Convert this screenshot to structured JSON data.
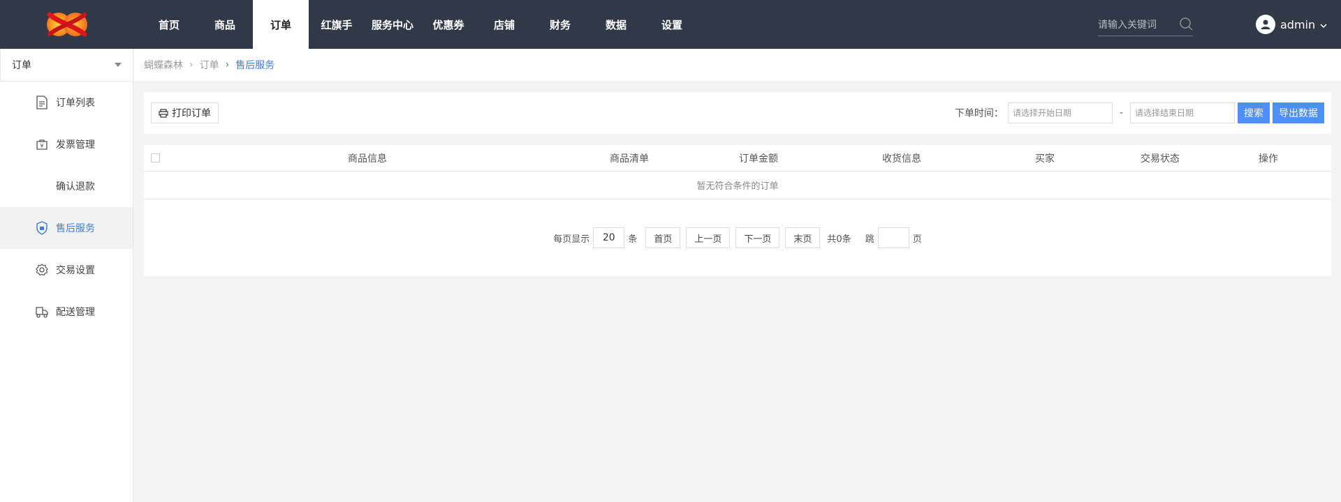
{
  "header": {
    "logo_icon": "colorful-knot-logo",
    "nav": [
      {
        "label": "首页"
      },
      {
        "label": "商品"
      },
      {
        "label": "订单",
        "active": true
      },
      {
        "label": "红旗手"
      },
      {
        "label": "服务中心"
      },
      {
        "label": "优惠券"
      },
      {
        "label": "店铺"
      },
      {
        "label": "财务"
      },
      {
        "label": "数据"
      },
      {
        "label": "设置"
      }
    ],
    "search": {
      "placeholder": "请输入关键词",
      "value": ""
    },
    "user": {
      "name": "admin"
    }
  },
  "sidebar": {
    "select": {
      "value": "订单"
    },
    "items": [
      {
        "label": "订单列表",
        "icon": "document-list-icon"
      },
      {
        "label": "发票管理",
        "icon": "invoice-icon"
      },
      {
        "label": "确认退款",
        "icon": ""
      },
      {
        "label": "售后服务",
        "icon": "shield-icon",
        "active": true
      },
      {
        "label": "交易设置",
        "icon": "gear-icon"
      },
      {
        "label": "配送管理",
        "icon": "delivery-icon"
      }
    ]
  },
  "breadcrumb": {
    "items": [
      "蝴蝶森林",
      "订单",
      "售后服务"
    ]
  },
  "toolbar": {
    "print_label": "打印订单",
    "order_time_label": "下单时间：",
    "start_date_placeholder": "请选择开始日期",
    "end_date_placeholder": "请选择结束日期",
    "dash": "-",
    "search_label": "搜索",
    "export_label": "导出数据"
  },
  "table": {
    "columns": [
      "商品信息",
      "商品清单",
      "订单金额",
      "收货信息",
      "买家",
      "交易状态",
      "操作"
    ],
    "empty_text": "暂无符合条件的订单"
  },
  "pager": {
    "per_page_label": "每页显示",
    "per_page_value": "20",
    "unit": "条",
    "first": "首页",
    "prev": "上一页",
    "next": "下一页",
    "last": "末页",
    "total": "共0条",
    "jump_label": "跳",
    "jump_value": "",
    "page_unit": "页"
  },
  "colors": {
    "topbar": "#313847",
    "accent": "#4c8ff5",
    "active_text": "#3a7ee6"
  }
}
